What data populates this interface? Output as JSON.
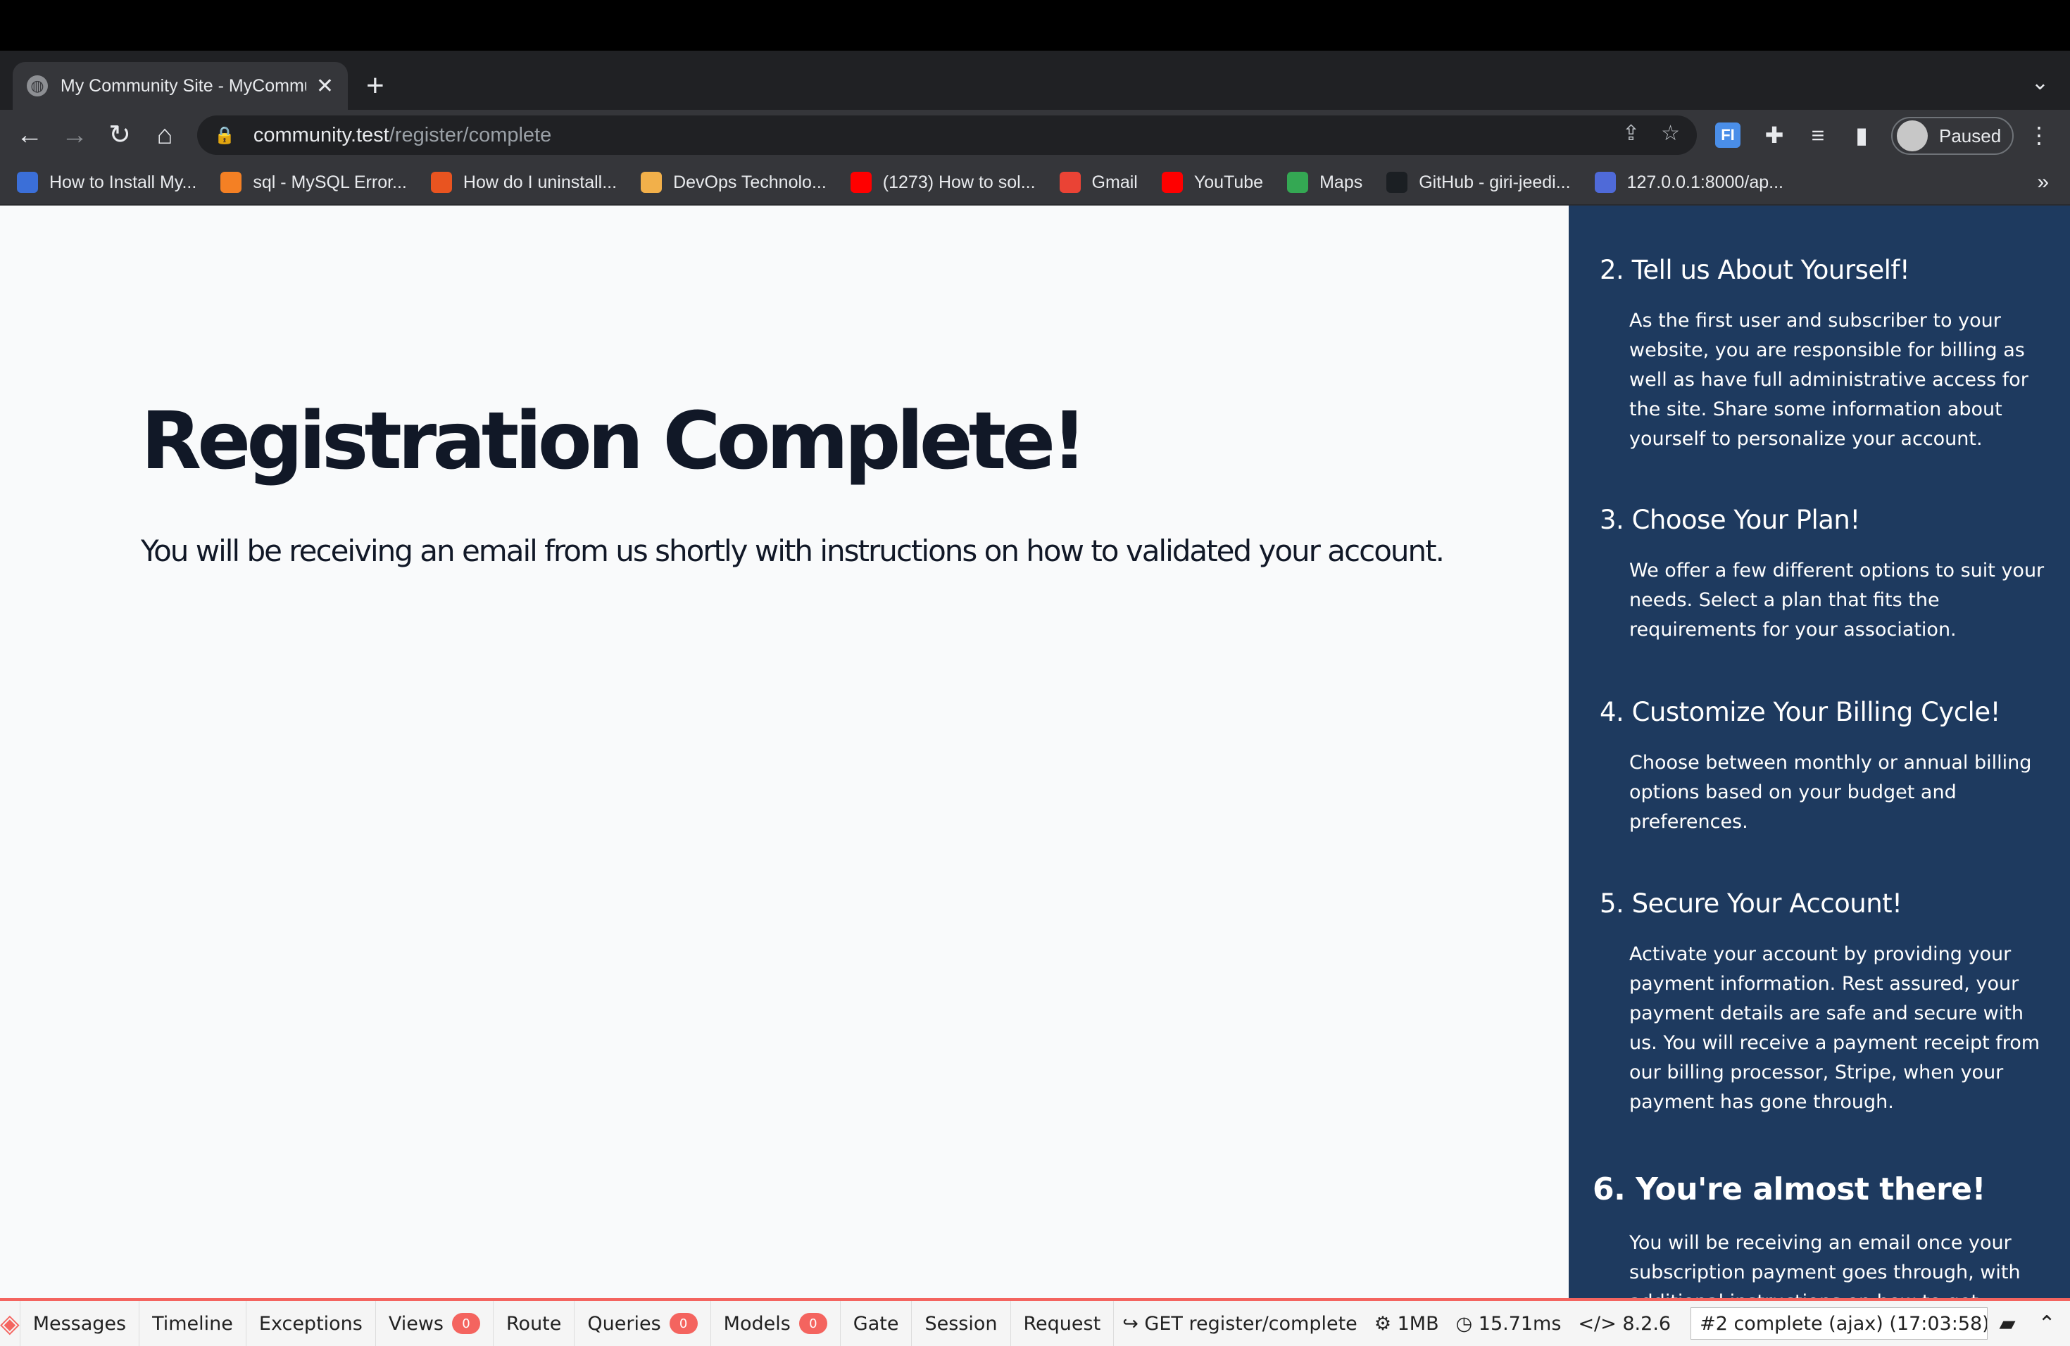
{
  "browser": {
    "tab": {
      "title": "My Community Site - MyCommunity"
    },
    "url": {
      "host": "community.test",
      "path": "/register/complete"
    },
    "profile": {
      "label": "Paused"
    },
    "bookmarks": [
      {
        "label": "How to Install My...",
        "color": "#3b6fd8"
      },
      {
        "label": "sql - MySQL Error...",
        "color": "#f48024"
      },
      {
        "label": "How do I uninstall...",
        "color": "#e95420"
      },
      {
        "label": "DevOps Technolo...",
        "color": "#f2b04a"
      },
      {
        "label": "(1273) How to sol...",
        "color": "#ff0000"
      },
      {
        "label": "Gmail",
        "color": "#ea4335"
      },
      {
        "label": "YouTube",
        "color": "#ff0000"
      },
      {
        "label": "Maps",
        "color": "#34a853"
      },
      {
        "label": "GitHub - giri-jeedi...",
        "color": "#1b1f23"
      },
      {
        "label": "127.0.0.1:8000/ap...",
        "color": "#4f6ad8"
      }
    ]
  },
  "main": {
    "title": "Registration Complete!",
    "message": "You will be receiving an email from us shortly with instructions on how to validated your account."
  },
  "sidebar": {
    "steps": [
      {
        "title": "2. Tell us About Yourself!",
        "desc": "As the first user and subscriber to your website, you are responsible for billing as well as have full administrative access for the site. Share some information about yourself to personalize your account."
      },
      {
        "title": "3. Choose Your Plan!",
        "desc": "We offer a few different options to suit your needs. Select a plan that fits the requirements for your association."
      },
      {
        "title": "4. Customize Your Billing Cycle!",
        "desc": "Choose between monthly or annual billing options based on your budget and preferences."
      },
      {
        "title": "5. Secure Your Account!",
        "desc": "Activate your account by providing your payment information. Rest assured, your payment details are safe and secure with us. You will receive a payment receipt from our billing processor, Stripe, when your payment has gone through."
      },
      {
        "title": "6. You're almost there!",
        "desc": "You will be receiving an email once your subscription payment goes through, with additional instructions on how to get"
      }
    ]
  },
  "debugbar": {
    "tabs": [
      {
        "label": "Messages"
      },
      {
        "label": "Timeline"
      },
      {
        "label": "Exceptions"
      },
      {
        "label": "Views",
        "badge": "0"
      },
      {
        "label": "Route"
      },
      {
        "label": "Queries",
        "badge": "0"
      },
      {
        "label": "Models",
        "badge": "0"
      },
      {
        "label": "Gate"
      },
      {
        "label": "Session"
      },
      {
        "label": "Request"
      }
    ],
    "route": "GET register/complete",
    "memory": "1MB",
    "time": "15.71ms",
    "php": "8.2.6",
    "request": "#2 complete (ajax) (17:03:58)"
  }
}
